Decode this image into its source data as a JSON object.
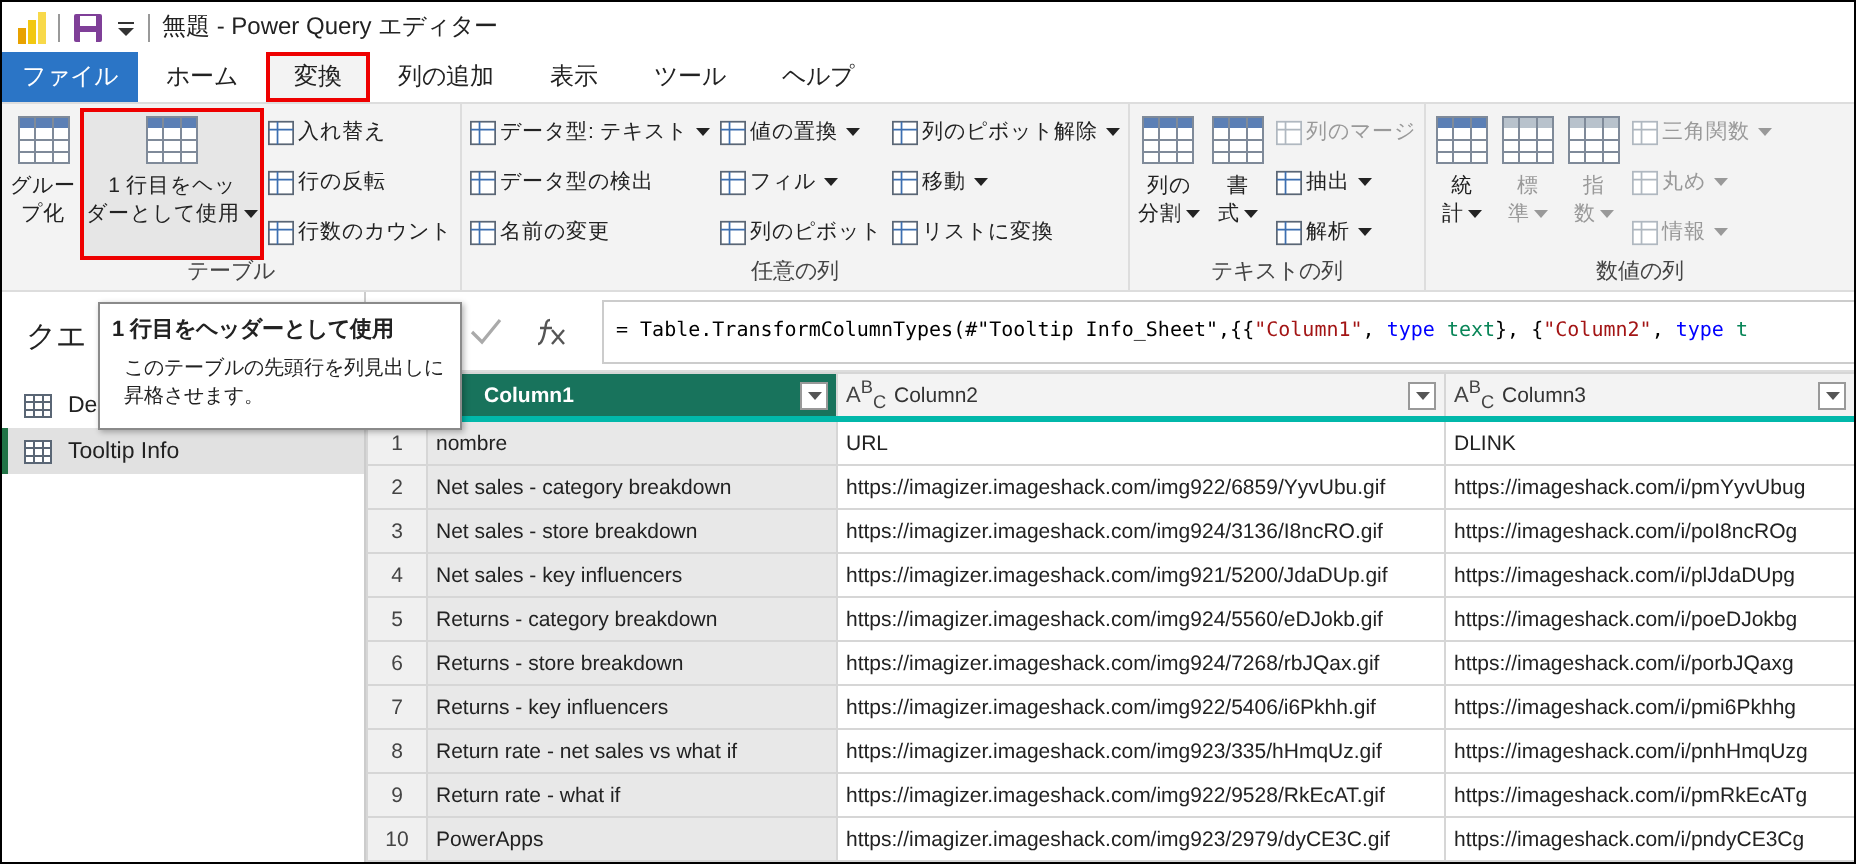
{
  "window": {
    "title": "無題 - Power Query エディター"
  },
  "tabs": [
    {
      "label": "ファイル",
      "kind": "file",
      "selected": false,
      "highlighted": false
    },
    {
      "label": "ホーム",
      "kind": "tab",
      "selected": false,
      "highlighted": false
    },
    {
      "label": "変換",
      "kind": "tab",
      "selected": true,
      "highlighted": true
    },
    {
      "label": "列の追加",
      "kind": "tab",
      "selected": false,
      "highlighted": false
    },
    {
      "label": "表示",
      "kind": "tab",
      "selected": false,
      "highlighted": false
    },
    {
      "label": "ツール",
      "kind": "tab",
      "selected": false,
      "highlighted": false
    },
    {
      "label": "ヘルプ",
      "kind": "tab",
      "selected": false,
      "highlighted": false
    }
  ],
  "ribbon": {
    "groups": [
      {
        "label": "テーブル",
        "items": [
          {
            "kind": "large",
            "lines": [
              "グルー",
              "プ化"
            ],
            "dropdown": false,
            "disabled": false,
            "highlighted": false
          },
          {
            "kind": "large",
            "lines": [
              "1 行目をヘッ",
              "ダーとして使用"
            ],
            "dropdown": true,
            "disabled": false,
            "highlighted": true
          },
          {
            "kind": "stack",
            "items": [
              {
                "label": "入れ替え",
                "dropdown": false,
                "disabled": false
              },
              {
                "label": "行の反転",
                "dropdown": false,
                "disabled": false
              },
              {
                "label": "行数のカウント",
                "dropdown": false,
                "disabled": false
              }
            ]
          }
        ]
      },
      {
        "label": "任意の列",
        "items": [
          {
            "kind": "stack",
            "items": [
              {
                "label": "データ型: テキスト",
                "dropdown": true,
                "disabled": false
              },
              {
                "label": "データ型の検出",
                "dropdown": false,
                "disabled": false
              },
              {
                "label": "名前の変更",
                "dropdown": false,
                "disabled": false
              }
            ]
          },
          {
            "kind": "stack",
            "items": [
              {
                "label": "値の置換",
                "dropdown": true,
                "disabled": false
              },
              {
                "label": "フィル",
                "dropdown": true,
                "disabled": false
              },
              {
                "label": "列のピボット",
                "dropdown": false,
                "disabled": false
              }
            ]
          },
          {
            "kind": "stack",
            "items": [
              {
                "label": "列のピボット解除",
                "dropdown": true,
                "disabled": false
              },
              {
                "label": "移動",
                "dropdown": true,
                "disabled": false
              },
              {
                "label": "リストに変換",
                "dropdown": false,
                "disabled": false
              }
            ]
          }
        ]
      },
      {
        "label": "テキストの列",
        "items": [
          {
            "kind": "large",
            "lines": [
              "列の",
              "分割"
            ],
            "dropdown": true,
            "disabled": false,
            "highlighted": false
          },
          {
            "kind": "large",
            "lines": [
              "書",
              "式"
            ],
            "dropdown": true,
            "disabled": false,
            "highlighted": false
          },
          {
            "kind": "stack",
            "items": [
              {
                "label": "列のマージ",
                "dropdown": false,
                "disabled": true
              },
              {
                "label": "抽出",
                "dropdown": true,
                "disabled": false
              },
              {
                "label": "解析",
                "dropdown": true,
                "disabled": false
              }
            ]
          }
        ]
      },
      {
        "label": "数値の列",
        "items": [
          {
            "kind": "large",
            "lines": [
              "統",
              "計"
            ],
            "dropdown": true,
            "disabled": false,
            "highlighted": false
          },
          {
            "kind": "large",
            "lines": [
              "標",
              "準"
            ],
            "dropdown": true,
            "disabled": true,
            "highlighted": false
          },
          {
            "kind": "large",
            "lines": [
              "指",
              "数"
            ],
            "dropdown": true,
            "disabled": true,
            "highlighted": false
          },
          {
            "kind": "stack",
            "items": [
              {
                "label": "三角関数",
                "dropdown": true,
                "disabled": true
              },
              {
                "label": "丸め",
                "dropdown": true,
                "disabled": true
              },
              {
                "label": "情報",
                "dropdown": true,
                "disabled": true
              }
            ]
          }
        ]
      }
    ]
  },
  "queries": {
    "title": "クエ",
    "items": [
      {
        "label": "De",
        "selected": false
      },
      {
        "label": "Tooltip Info",
        "selected": true
      }
    ]
  },
  "formula": [
    {
      "kind": "plain",
      "text": "= Table.TransformColumnTypes(#\"Tooltip Info_Sheet\",{{"
    },
    {
      "kind": "string",
      "text": "\"Column1\""
    },
    {
      "kind": "plain",
      "text": ", "
    },
    {
      "kind": "keyword",
      "text": "type"
    },
    {
      "kind": "type",
      "text": " text"
    },
    {
      "kind": "plain",
      "text": "}, {"
    },
    {
      "kind": "string",
      "text": "\"Column2\""
    },
    {
      "kind": "plain",
      "text": ", "
    },
    {
      "kind": "keyword",
      "text": "type"
    },
    {
      "kind": "type",
      "text": " t"
    }
  ],
  "tooltip": {
    "title": "1 行目をヘッダーとして使用",
    "body": "このテーブルの先頭行を列見出しに昇格させます。"
  },
  "table": {
    "columns": [
      {
        "name": "Column1",
        "selected": true
      },
      {
        "name": "Column2",
        "type_label": "A$^{B}$$_{C}$",
        "selected": false
      },
      {
        "name": "Column3",
        "type_label": "A$^{B}$$_{C}$",
        "selected": false
      }
    ],
    "rows": [
      {
        "num": "1",
        "cells": [
          "nombre",
          "URL",
          "DLINK"
        ]
      },
      {
        "num": "2",
        "cells": [
          "Net sales - category breakdown",
          "https://imagizer.imageshack.com/img922/6859/YyvUbu.gif",
          "https://imageshack.com/i/pmYyvUbug"
        ]
      },
      {
        "num": "3",
        "cells": [
          "Net sales - store breakdown",
          "https://imagizer.imageshack.com/img924/3136/I8ncRO.gif",
          "https://imageshack.com/i/poI8ncROg"
        ]
      },
      {
        "num": "4",
        "cells": [
          "Net sales - key influencers",
          "https://imagizer.imageshack.com/img921/5200/JdaDUp.gif",
          "https://imageshack.com/i/plJdaDUpg"
        ]
      },
      {
        "num": "5",
        "cells": [
          "Returns - category breakdown",
          "https://imagizer.imageshack.com/img924/5560/eDJokb.gif",
          "https://imageshack.com/i/poeDJokbg"
        ]
      },
      {
        "num": "6",
        "cells": [
          "Returns - store breakdown",
          "https://imagizer.imageshack.com/img924/7268/rbJQax.gif",
          "https://imageshack.com/i/porbJQaxg"
        ]
      },
      {
        "num": "7",
        "cells": [
          "Returns - key influencers",
          "https://imagizer.imageshack.com/img922/5406/i6Pkhh.gif",
          "https://imageshack.com/i/pmi6Pkhhg"
        ]
      },
      {
        "num": "8",
        "cells": [
          "Return rate - net sales vs what if",
          "https://imagizer.imageshack.com/img923/335/hHmqUz.gif",
          "https://imageshack.com/i/pnhHmqUzg"
        ]
      },
      {
        "num": "9",
        "cells": [
          "Return rate - what if",
          "https://imagizer.imageshack.com/img922/9528/RkEcAT.gif",
          "https://imageshack.com/i/pmRkEcATg"
        ]
      },
      {
        "num": "10",
        "cells": [
          "PowerApps",
          "https://imagizer.imageshack.com/img923/2979/dyCE3C.gif",
          "https://imageshack.com/i/pndyCE3Cg"
        ]
      }
    ]
  }
}
